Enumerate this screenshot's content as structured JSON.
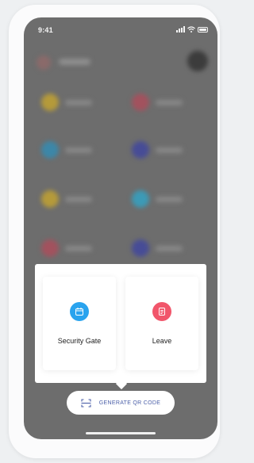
{
  "status_bar": {
    "time": "9:41"
  },
  "colors": {
    "security_accent": "#29a3ee",
    "leave_accent": "#f1566b",
    "qr_text": "#4b5fa8"
  },
  "menu_options": [
    {
      "label": "Security Gate",
      "icon": "calendar-icon"
    },
    {
      "label": "Leave",
      "icon": "document-icon"
    }
  ],
  "qr_button": {
    "label": "GENERATE QR CODE",
    "icon": "scan-icon"
  }
}
